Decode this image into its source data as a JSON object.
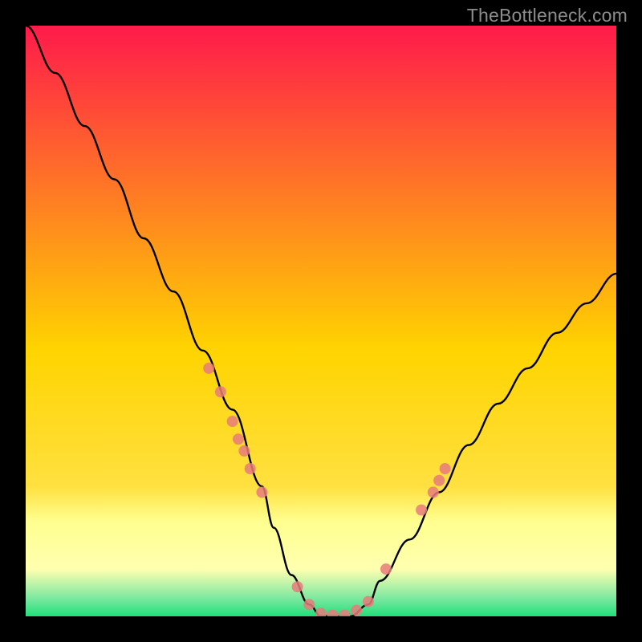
{
  "watermark": "TheBottleneck.com",
  "colors": {
    "top": "#ff1a4b",
    "mid": "#ffd400",
    "band_light": "#ffff90",
    "bottom": "#1fe07a",
    "curve": "#000000",
    "marker": "#e77b7b",
    "frame": "#000000"
  },
  "chart_data": {
    "type": "line",
    "title": "",
    "xlabel": "",
    "ylabel": "",
    "xlim": [
      0,
      100
    ],
    "ylim": [
      0,
      100
    ],
    "curve": {
      "x": [
        0,
        5,
        10,
        15,
        20,
        25,
        30,
        35,
        40,
        42,
        45,
        48,
        50,
        52,
        55,
        58,
        60,
        65,
        70,
        75,
        80,
        85,
        90,
        95,
        100
      ],
      "y": [
        100,
        92,
        83,
        74,
        64,
        55,
        45,
        35,
        22,
        15,
        7,
        2,
        0,
        0,
        0,
        2,
        6,
        13,
        21,
        29,
        36,
        42,
        48,
        53,
        58
      ]
    },
    "trough_range_x": [
      48,
      58
    ],
    "markers": [
      {
        "x": 31,
        "y": 42
      },
      {
        "x": 33,
        "y": 38
      },
      {
        "x": 35,
        "y": 33
      },
      {
        "x": 36,
        "y": 30
      },
      {
        "x": 37,
        "y": 28
      },
      {
        "x": 38,
        "y": 25
      },
      {
        "x": 40,
        "y": 21
      },
      {
        "x": 46,
        "y": 5
      },
      {
        "x": 48,
        "y": 2
      },
      {
        "x": 50,
        "y": 0.5
      },
      {
        "x": 52,
        "y": 0.2
      },
      {
        "x": 54,
        "y": 0.2
      },
      {
        "x": 56,
        "y": 1
      },
      {
        "x": 58,
        "y": 2.5
      },
      {
        "x": 61,
        "y": 8
      },
      {
        "x": 67,
        "y": 18
      },
      {
        "x": 69,
        "y": 21
      },
      {
        "x": 70,
        "y": 23
      },
      {
        "x": 71,
        "y": 25
      }
    ]
  }
}
